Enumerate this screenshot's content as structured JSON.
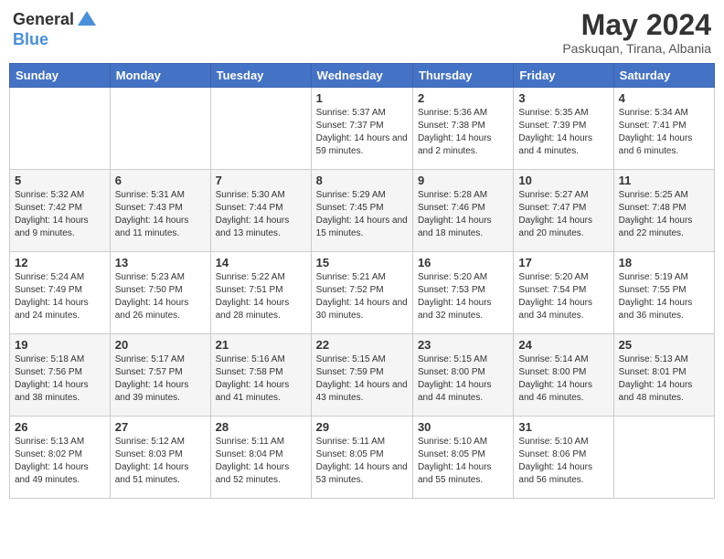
{
  "logo": {
    "general": "General",
    "blue": "Blue"
  },
  "title": "May 2024",
  "subtitle": "Paskuqan, Tirana, Albania",
  "headers": [
    "Sunday",
    "Monday",
    "Tuesday",
    "Wednesday",
    "Thursday",
    "Friday",
    "Saturday"
  ],
  "weeks": [
    [
      {
        "day": "",
        "sunrise": "",
        "sunset": "",
        "daylight": ""
      },
      {
        "day": "",
        "sunrise": "",
        "sunset": "",
        "daylight": ""
      },
      {
        "day": "",
        "sunrise": "",
        "sunset": "",
        "daylight": ""
      },
      {
        "day": "1",
        "sunrise": "Sunrise: 5:37 AM",
        "sunset": "Sunset: 7:37 PM",
        "daylight": "Daylight: 14 hours and 59 minutes."
      },
      {
        "day": "2",
        "sunrise": "Sunrise: 5:36 AM",
        "sunset": "Sunset: 7:38 PM",
        "daylight": "Daylight: 14 hours and 2 minutes."
      },
      {
        "day": "3",
        "sunrise": "Sunrise: 5:35 AM",
        "sunset": "Sunset: 7:39 PM",
        "daylight": "Daylight: 14 hours and 4 minutes."
      },
      {
        "day": "4",
        "sunrise": "Sunrise: 5:34 AM",
        "sunset": "Sunset: 7:41 PM",
        "daylight": "Daylight: 14 hours and 6 minutes."
      }
    ],
    [
      {
        "day": "5",
        "sunrise": "Sunrise: 5:32 AM",
        "sunset": "Sunset: 7:42 PM",
        "daylight": "Daylight: 14 hours and 9 minutes."
      },
      {
        "day": "6",
        "sunrise": "Sunrise: 5:31 AM",
        "sunset": "Sunset: 7:43 PM",
        "daylight": "Daylight: 14 hours and 11 minutes."
      },
      {
        "day": "7",
        "sunrise": "Sunrise: 5:30 AM",
        "sunset": "Sunset: 7:44 PM",
        "daylight": "Daylight: 14 hours and 13 minutes."
      },
      {
        "day": "8",
        "sunrise": "Sunrise: 5:29 AM",
        "sunset": "Sunset: 7:45 PM",
        "daylight": "Daylight: 14 hours and 15 minutes."
      },
      {
        "day": "9",
        "sunrise": "Sunrise: 5:28 AM",
        "sunset": "Sunset: 7:46 PM",
        "daylight": "Daylight: 14 hours and 18 minutes."
      },
      {
        "day": "10",
        "sunrise": "Sunrise: 5:27 AM",
        "sunset": "Sunset: 7:47 PM",
        "daylight": "Daylight: 14 hours and 20 minutes."
      },
      {
        "day": "11",
        "sunrise": "Sunrise: 5:25 AM",
        "sunset": "Sunset: 7:48 PM",
        "daylight": "Daylight: 14 hours and 22 minutes."
      }
    ],
    [
      {
        "day": "12",
        "sunrise": "Sunrise: 5:24 AM",
        "sunset": "Sunset: 7:49 PM",
        "daylight": "Daylight: 14 hours and 24 minutes."
      },
      {
        "day": "13",
        "sunrise": "Sunrise: 5:23 AM",
        "sunset": "Sunset: 7:50 PM",
        "daylight": "Daylight: 14 hours and 26 minutes."
      },
      {
        "day": "14",
        "sunrise": "Sunrise: 5:22 AM",
        "sunset": "Sunset: 7:51 PM",
        "daylight": "Daylight: 14 hours and 28 minutes."
      },
      {
        "day": "15",
        "sunrise": "Sunrise: 5:21 AM",
        "sunset": "Sunset: 7:52 PM",
        "daylight": "Daylight: 14 hours and 30 minutes."
      },
      {
        "day": "16",
        "sunrise": "Sunrise: 5:20 AM",
        "sunset": "Sunset: 7:53 PM",
        "daylight": "Daylight: 14 hours and 32 minutes."
      },
      {
        "day": "17",
        "sunrise": "Sunrise: 5:20 AM",
        "sunset": "Sunset: 7:54 PM",
        "daylight": "Daylight: 14 hours and 34 minutes."
      },
      {
        "day": "18",
        "sunrise": "Sunrise: 5:19 AM",
        "sunset": "Sunset: 7:55 PM",
        "daylight": "Daylight: 14 hours and 36 minutes."
      }
    ],
    [
      {
        "day": "19",
        "sunrise": "Sunrise: 5:18 AM",
        "sunset": "Sunset: 7:56 PM",
        "daylight": "Daylight: 14 hours and 38 minutes."
      },
      {
        "day": "20",
        "sunrise": "Sunrise: 5:17 AM",
        "sunset": "Sunset: 7:57 PM",
        "daylight": "Daylight: 14 hours and 39 minutes."
      },
      {
        "day": "21",
        "sunrise": "Sunrise: 5:16 AM",
        "sunset": "Sunset: 7:58 PM",
        "daylight": "Daylight: 14 hours and 41 minutes."
      },
      {
        "day": "22",
        "sunrise": "Sunrise: 5:15 AM",
        "sunset": "Sunset: 7:59 PM",
        "daylight": "Daylight: 14 hours and 43 minutes."
      },
      {
        "day": "23",
        "sunrise": "Sunrise: 5:15 AM",
        "sunset": "Sunset: 8:00 PM",
        "daylight": "Daylight: 14 hours and 44 minutes."
      },
      {
        "day": "24",
        "sunrise": "Sunrise: 5:14 AM",
        "sunset": "Sunset: 8:00 PM",
        "daylight": "Daylight: 14 hours and 46 minutes."
      },
      {
        "day": "25",
        "sunrise": "Sunrise: 5:13 AM",
        "sunset": "Sunset: 8:01 PM",
        "daylight": "Daylight: 14 hours and 48 minutes."
      }
    ],
    [
      {
        "day": "26",
        "sunrise": "Sunrise: 5:13 AM",
        "sunset": "Sunset: 8:02 PM",
        "daylight": "Daylight: 14 hours and 49 minutes."
      },
      {
        "day": "27",
        "sunrise": "Sunrise: 5:12 AM",
        "sunset": "Sunset: 8:03 PM",
        "daylight": "Daylight: 14 hours and 51 minutes."
      },
      {
        "day": "28",
        "sunrise": "Sunrise: 5:11 AM",
        "sunset": "Sunset: 8:04 PM",
        "daylight": "Daylight: 14 hours and 52 minutes."
      },
      {
        "day": "29",
        "sunrise": "Sunrise: 5:11 AM",
        "sunset": "Sunset: 8:05 PM",
        "daylight": "Daylight: 14 hours and 53 minutes."
      },
      {
        "day": "30",
        "sunrise": "Sunrise: 5:10 AM",
        "sunset": "Sunset: 8:05 PM",
        "daylight": "Daylight: 14 hours and 55 minutes."
      },
      {
        "day": "31",
        "sunrise": "Sunrise: 5:10 AM",
        "sunset": "Sunset: 8:06 PM",
        "daylight": "Daylight: 14 hours and 56 minutes."
      },
      {
        "day": "",
        "sunrise": "",
        "sunset": "",
        "daylight": ""
      }
    ]
  ]
}
